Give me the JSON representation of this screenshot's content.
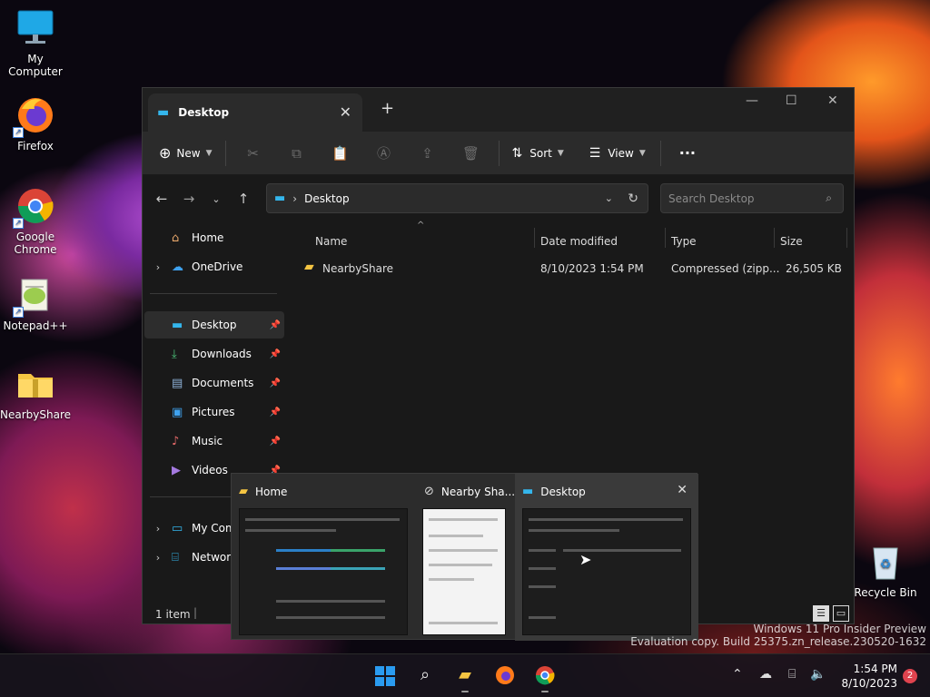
{
  "desktop": {
    "icons": [
      {
        "label": "My Computer"
      },
      {
        "label": "Firefox"
      },
      {
        "label": "Google Chrome"
      },
      {
        "label": "Notepad++"
      },
      {
        "label": "NearbyShare"
      },
      {
        "label": "Recycle Bin"
      }
    ]
  },
  "explorer": {
    "tab_title": "Desktop",
    "toolbar": {
      "new_label": "New",
      "sort_label": "Sort",
      "view_label": "View"
    },
    "address": {
      "path": "Desktop",
      "search_placeholder": "Search Desktop"
    },
    "nav": [
      {
        "label": "Home"
      },
      {
        "label": "OneDrive"
      },
      {
        "label": "Desktop"
      },
      {
        "label": "Downloads"
      },
      {
        "label": "Documents"
      },
      {
        "label": "Pictures"
      },
      {
        "label": "Music"
      },
      {
        "label": "Videos"
      },
      {
        "label": "My Com"
      },
      {
        "label": "Network"
      }
    ],
    "columns": [
      "Name",
      "Date modified",
      "Type",
      "Size"
    ],
    "files": [
      {
        "name": "NearbyShare",
        "date": "8/10/2023 1:54 PM",
        "type": "Compressed (zipp...",
        "size": "26,505 KB"
      }
    ],
    "status": "1 item"
  },
  "thumbnails": [
    {
      "title": "Home"
    },
    {
      "title": "Nearby Sha..."
    },
    {
      "title": "Desktop"
    }
  ],
  "taskbar": {
    "time": "1:54 PM",
    "date": "8/10/2023",
    "notification_count": "2"
  },
  "watermark": {
    "line1": "Windows 11 Pro Insider Preview",
    "line2": "Evaluation copy. Build 25375.zn_release.230520-1632"
  }
}
